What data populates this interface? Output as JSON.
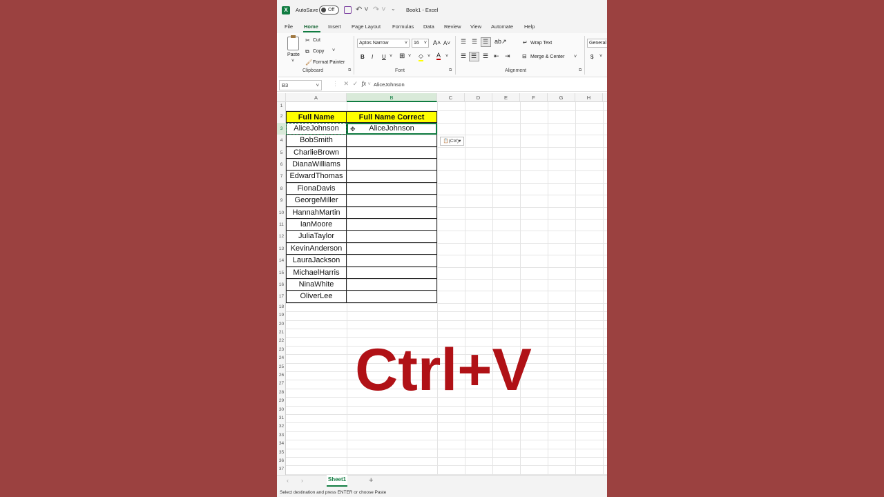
{
  "titlebar": {
    "autosave_label": "AutoSave",
    "autosave_state": "Off",
    "book_title": "Book1  -  Excel"
  },
  "tabs": [
    "File",
    "Home",
    "Insert",
    "Page Layout",
    "Formulas",
    "Data",
    "Review",
    "View",
    "Automate",
    "Help"
  ],
  "active_tab": "Home",
  "ribbon": {
    "clipboard": {
      "paste": "Paste",
      "cut": "Cut",
      "copy": "Copy",
      "format_painter": "Format Painter",
      "label": "Clipboard"
    },
    "font": {
      "family": "Aptos Narrow",
      "size": "16",
      "bold": "B",
      "italic": "I",
      "underline": "U",
      "label": "Font"
    },
    "alignment": {
      "wrap_text": "Wrap Text",
      "merge_center": "Merge & Center",
      "label": "Alignment"
    },
    "number": {
      "format": "General",
      "currency": "$"
    }
  },
  "formula_bar": {
    "name_box": "B3",
    "fx": "fx",
    "value": "AliceJohnson"
  },
  "columns": [
    "A",
    "B",
    "C",
    "D",
    "E",
    "F",
    "G",
    "H"
  ],
  "selected_column": "B",
  "rows": [
    "1",
    "2",
    "3",
    "4",
    "5",
    "6",
    "7",
    "8",
    "9",
    "10",
    "11",
    "12",
    "13",
    "14",
    "15",
    "16",
    "17",
    "18",
    "19",
    "20",
    "21",
    "22",
    "23",
    "24",
    "25",
    "26",
    "27",
    "28",
    "29",
    "30",
    "31",
    "32",
    "33",
    "34",
    "35",
    "36",
    "37"
  ],
  "table": {
    "header_a": "Full Name",
    "header_b": "Full Name Correct",
    "names": [
      "AliceJohnson",
      "BobSmith",
      "CharlieBrown",
      "DianaWilliams",
      "EdwardThomas",
      "FionaDavis",
      "GeorgeMiller",
      "HannahMartin",
      "IanMoore",
      "JuliaTaylor",
      "KevinAnderson",
      "LauraJackson",
      "MichaelHarris",
      "NinaWhite",
      "OliverLee"
    ],
    "corrected": [
      "AliceJohnson"
    ]
  },
  "paste_options": "(Ctrl)",
  "overlay_text": "Ctrl+V",
  "sheet_tab": "Sheet1",
  "add_sheet": "+",
  "status": "Select destination and press ENTER or choose Paste",
  "colors": {
    "background": "#9b4140",
    "header_fill": "#ffff00",
    "excel_green": "#107c41",
    "overlay_red": "#b01116"
  }
}
